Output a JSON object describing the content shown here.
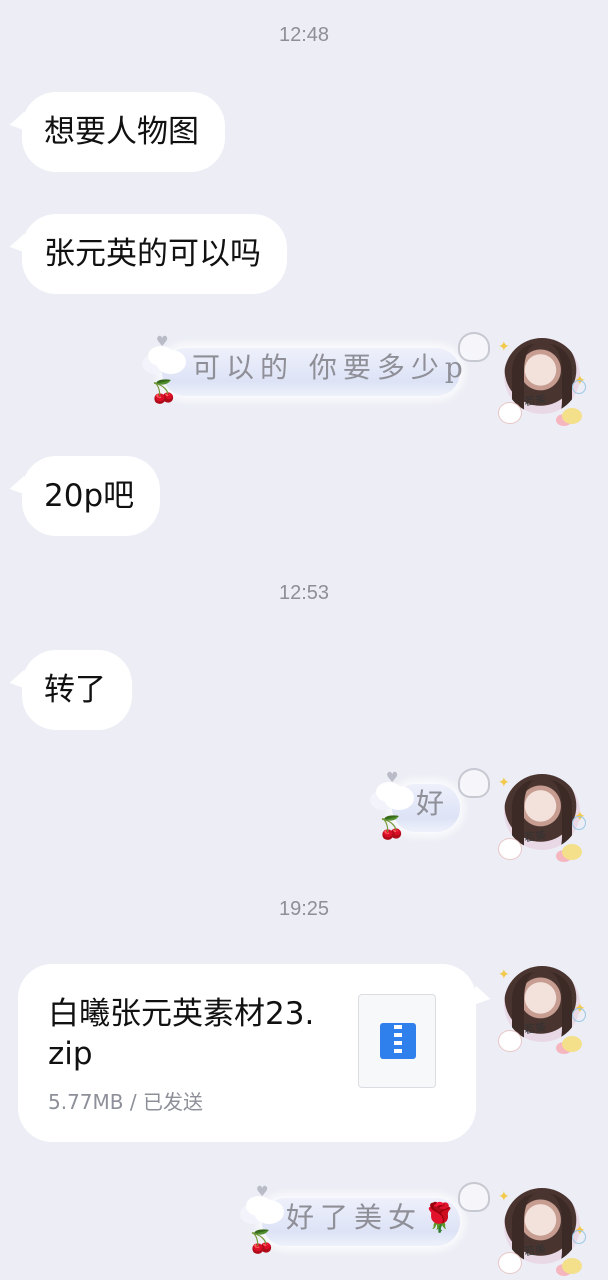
{
  "timestamps": [
    "12:48",
    "12:53",
    "19:25"
  ],
  "messages": {
    "in_1": "想要人物图",
    "in_2": "张元英的可以吗",
    "out_1": "可以的 你要多少p",
    "in_3": "20p吧",
    "in_4": "转了",
    "out_2": "好",
    "out_3": "好了美女"
  },
  "file": {
    "name": "白曦张元英素材23.zip",
    "size_status": "5.77MB / 已发送",
    "icon": "zip-file-icon"
  },
  "avatar": {
    "icon": "user-avatar-portrait"
  },
  "colors": {
    "background": "#ecedf5",
    "bubble": "#ffffff",
    "timestamp": "#8d8f99",
    "zip_icon": "#2f80ed",
    "rose": "#d7263d"
  }
}
